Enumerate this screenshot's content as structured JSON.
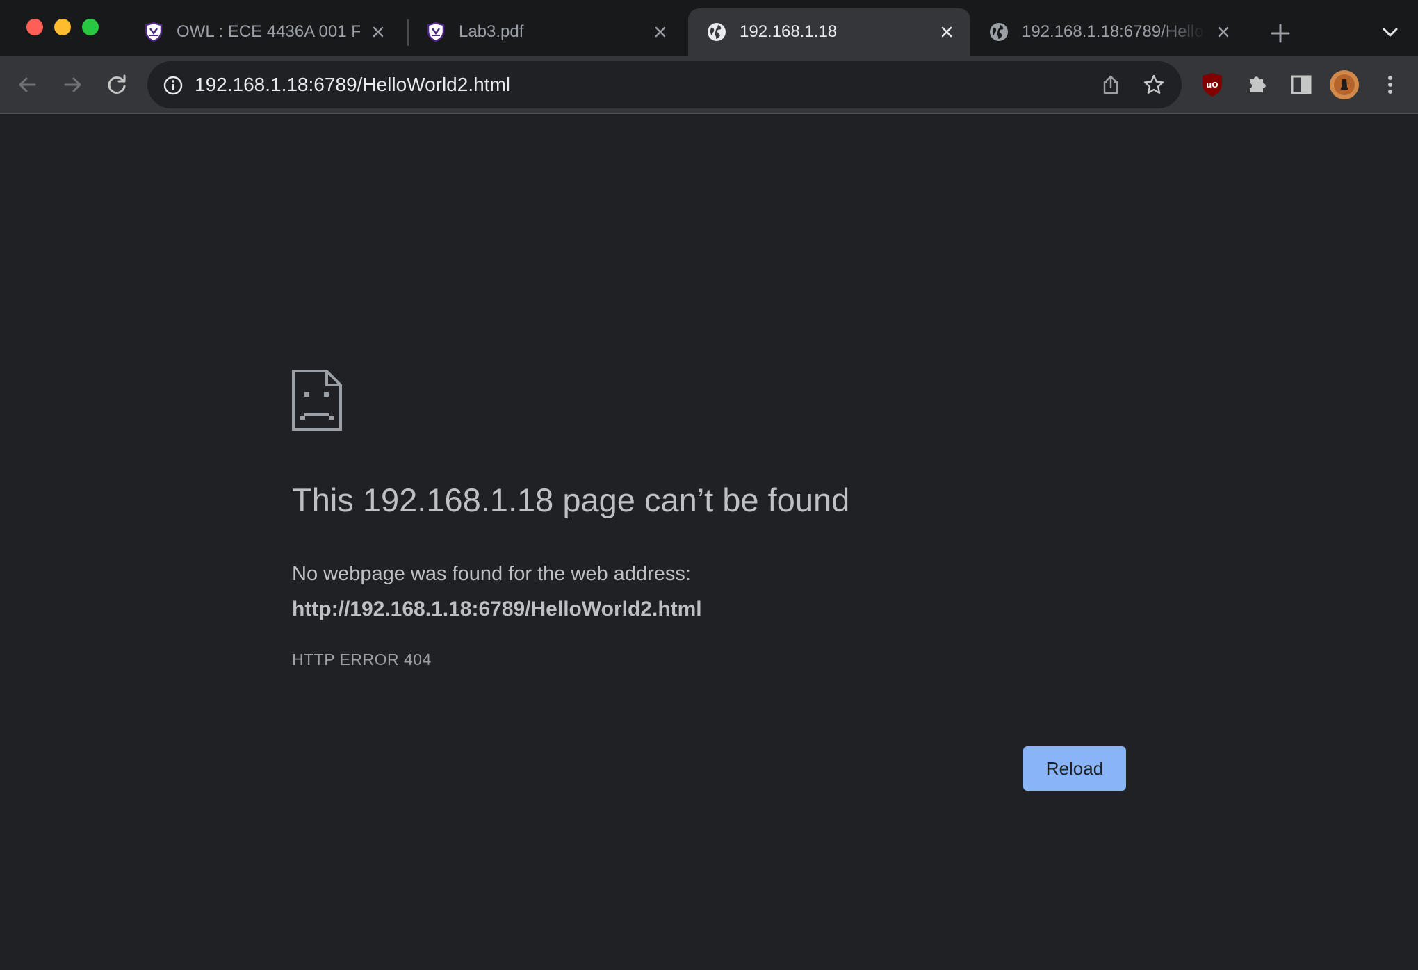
{
  "window_controls": [
    "close",
    "minimize",
    "zoom"
  ],
  "tabs": [
    {
      "title": "OWL : ECE 4436A 001 F",
      "icon": "shield-icon",
      "active": false
    },
    {
      "title": "Lab3.pdf",
      "icon": "shield-icon",
      "active": false
    },
    {
      "title": "192.168.1.18",
      "icon": "globe-icon",
      "active": true
    },
    {
      "title": "192.168.1.18:6789/Hello",
      "icon": "globe-icon",
      "active": false
    }
  ],
  "address_bar": {
    "url": "192.168.1.18:6789/HelloWorld2.html"
  },
  "toolbar_icons": [
    "back-icon",
    "forward-icon",
    "reload-icon",
    "share-icon",
    "star-icon",
    "ublock-icon",
    "extensions-icon",
    "side-panel-icon",
    "profile-avatar",
    "menu-icon"
  ],
  "error_page": {
    "heading": "This 192.168.1.18 page can’t be found",
    "description": "No webpage was found for the web address:",
    "url": "http://192.168.1.18:6789/HelloWorld2.html",
    "error_code": "HTTP ERROR 404",
    "reload_label": "Reload"
  },
  "colors": {
    "page_background": "#202124",
    "toolbar": "#35363a",
    "tab_strip": "#18191b",
    "reload_button": "#8ab4f8",
    "text_primary": "#bdc1c6",
    "ublock_red": "#800000"
  }
}
